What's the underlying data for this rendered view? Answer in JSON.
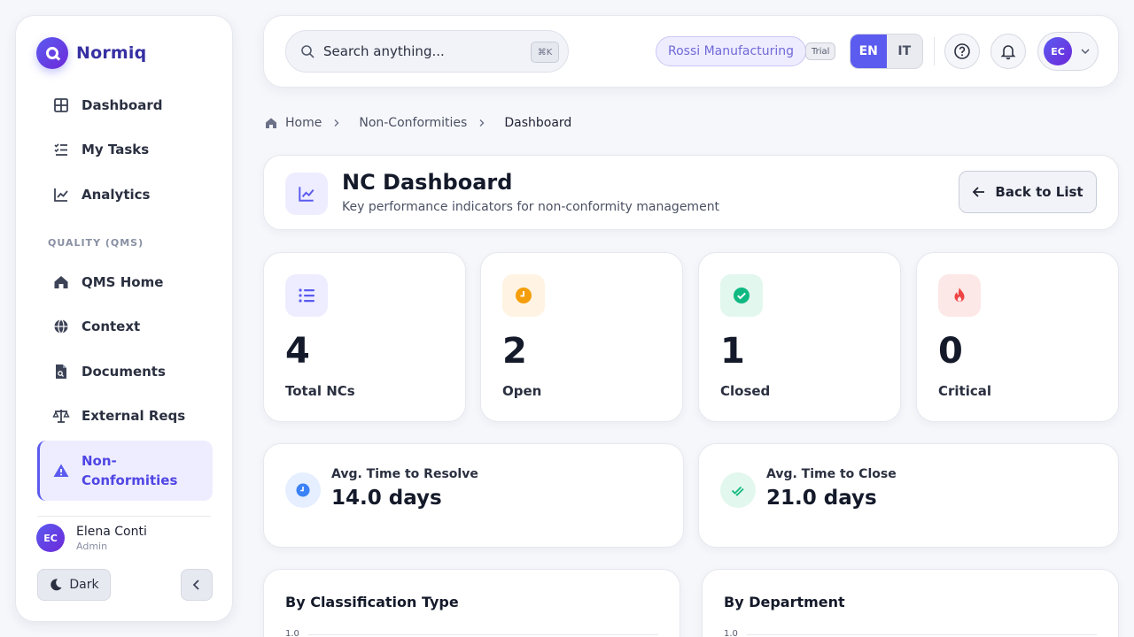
{
  "brand": {
    "name": "Normiq"
  },
  "sidebar": {
    "items": [
      {
        "label": "Dashboard",
        "icon": "grid-icon"
      },
      {
        "label": "My Tasks",
        "icon": "checklist-icon"
      },
      {
        "label": "Analytics",
        "icon": "chart-line-icon"
      }
    ],
    "section_label": "QUALITY (QMS)",
    "qms_items": [
      {
        "label": "QMS Home",
        "icon": "home-icon"
      },
      {
        "label": "Context",
        "icon": "globe-icon"
      },
      {
        "label": "Documents",
        "icon": "document-icon"
      },
      {
        "label": "External Reqs",
        "icon": "scale-icon"
      },
      {
        "label": "Non-\nConformities",
        "icon": "warning-icon",
        "active": true
      }
    ],
    "user": {
      "initials": "EC",
      "name": "Elena Conti",
      "role": "Admin"
    },
    "dark_label": "Dark"
  },
  "topbar": {
    "search_placeholder": "Search anything...",
    "shortcut": "⌘K",
    "org_name": "Rossi Manufacturing",
    "plan_badge": "Trial",
    "languages": [
      "EN",
      "IT"
    ],
    "active_language": "EN",
    "user_initials": "EC"
  },
  "breadcrumb": {
    "home": "Home",
    "section": "Non-Conformities",
    "current": "Dashboard"
  },
  "header": {
    "title": "NC Dashboard",
    "subtitle": "Key performance indicators for non-conformity management",
    "back_label": "Back to List"
  },
  "stats": [
    {
      "value": "4",
      "label": "Total NCs",
      "icon": "list-icon",
      "color": "#5b5bf0",
      "bg": "#eeedff"
    },
    {
      "value": "2",
      "label": "Open",
      "icon": "clock-icon",
      "color": "#f59e0b",
      "bg": "#fff3e3"
    },
    {
      "value": "1",
      "label": "Closed",
      "icon": "check-circle-icon",
      "color": "#10b981",
      "bg": "#e2f7ee"
    },
    {
      "value": "0",
      "label": "Critical",
      "icon": "fire-icon",
      "color": "#ef4444",
      "bg": "#fde8e8"
    }
  ],
  "times": [
    {
      "label": "Avg. Time to Resolve",
      "value": "14.0 days",
      "icon": "clock-icon",
      "color": "#3b82f6",
      "bg": "#e6efff"
    },
    {
      "label": "Avg. Time to Close",
      "value": "21.0 days",
      "icon": "double-check-icon",
      "color": "#10b981",
      "bg": "#e2f7ee"
    }
  ],
  "charts": [
    {
      "title": "By Classification Type",
      "top_tick": "1.0"
    },
    {
      "title": "By Department",
      "top_tick": "1.0"
    }
  ]
}
